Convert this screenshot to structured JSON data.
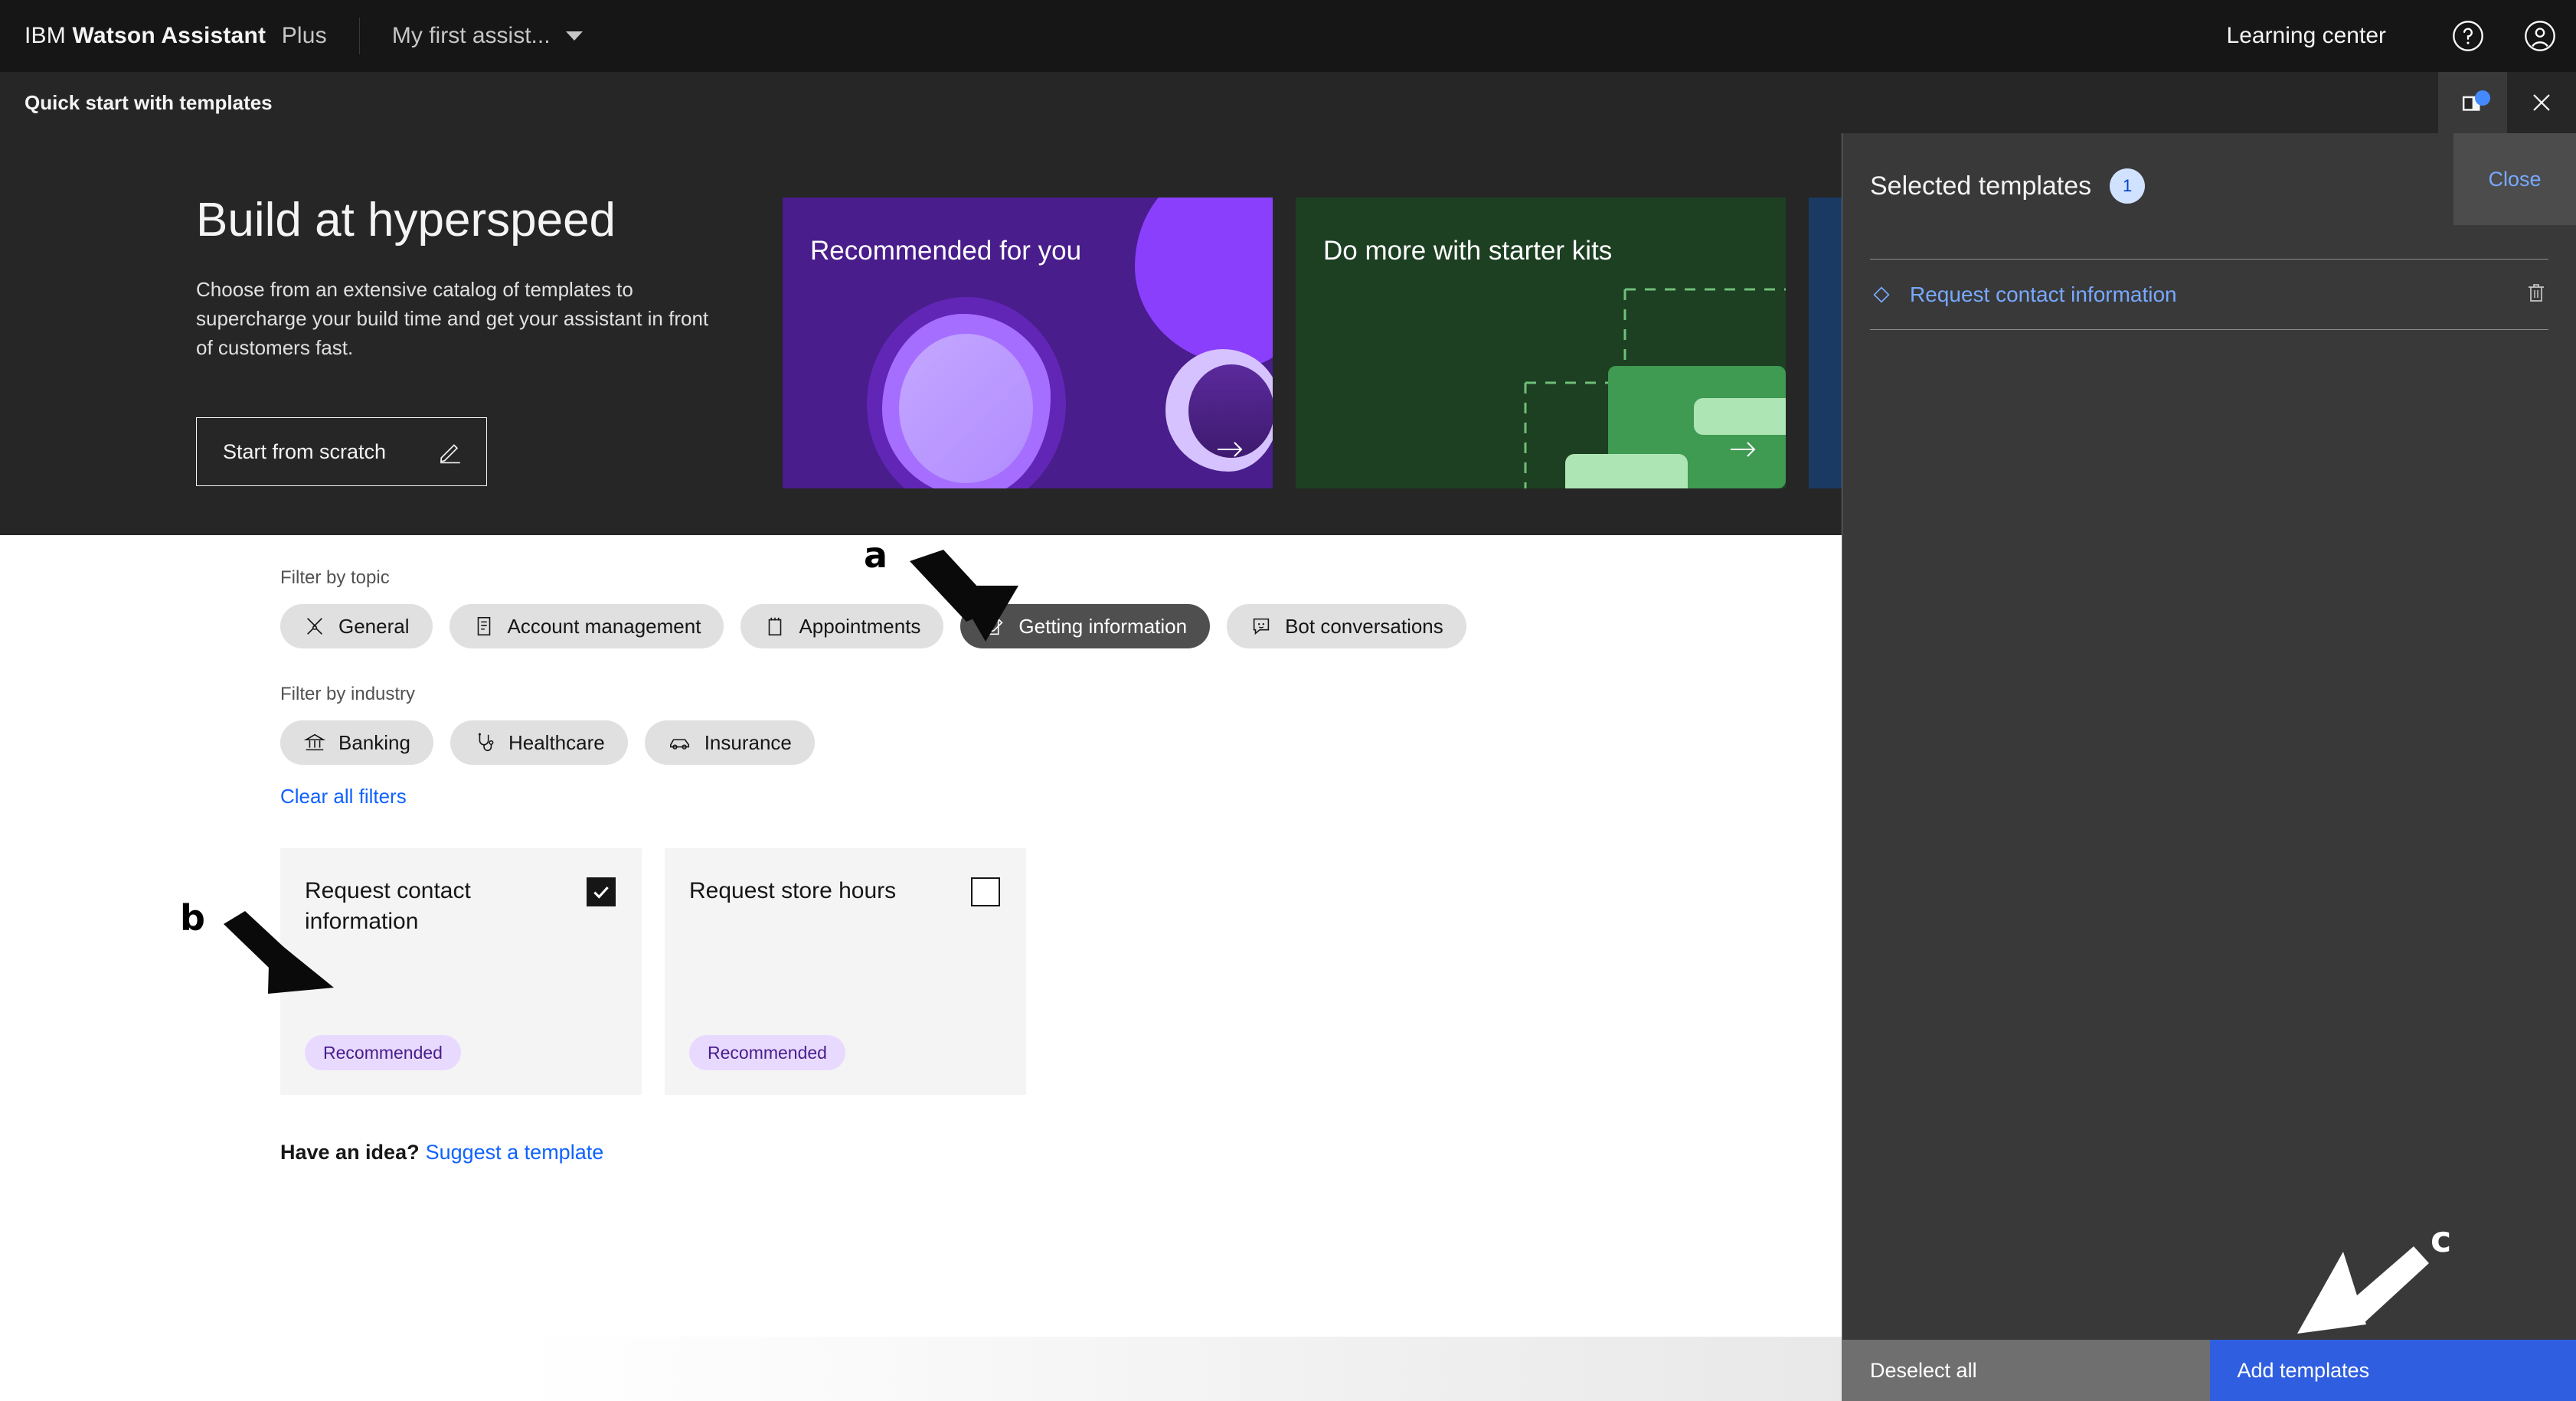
{
  "topbar": {
    "brand_prefix": "IBM",
    "brand_name": "Watson Assistant",
    "plan": "Plus",
    "assistant_name": "My first assist...",
    "learning_center": "Learning center",
    "help_icon": "help-circle-icon",
    "account_icon": "user-avatar-icon",
    "chevron_icon": "chevron-down-icon"
  },
  "panelbar": {
    "title": "Quick start with templates",
    "toggle_panel_icon": "side-panel-toggle-icon",
    "close_icon": "close-icon",
    "badge_color": "#4589ff"
  },
  "hero": {
    "heading": "Build at hyperspeed",
    "paragraph": "Choose from an extensive catalog of templates to supercharge your build time and get your assistant in front of customers fast.",
    "cta_label": "Start from scratch",
    "cta_icon": "edit-pencil-icon",
    "cards": [
      {
        "title": "Recommended for you",
        "color": "#491d8b",
        "arrow_icon": "arrow-right-icon"
      },
      {
        "title": "Do more with starter kits",
        "color": "#1d3f22",
        "arrow_icon": "arrow-right-icon"
      },
      {
        "title": "",
        "color": "#1a3a63",
        "arrow_icon": "arrow-right-icon"
      }
    ]
  },
  "filters": {
    "topic_label": "Filter by topic",
    "topic_chips": [
      {
        "label": "General",
        "icon": "tools-icon",
        "selected": false
      },
      {
        "label": "Account management",
        "icon": "document-list-icon",
        "selected": false
      },
      {
        "label": "Appointments",
        "icon": "calendar-icon",
        "selected": false
      },
      {
        "label": "Getting information",
        "icon": "edit-note-icon",
        "selected": true
      },
      {
        "label": "Bot conversations",
        "icon": "chat-bot-icon",
        "selected": false
      }
    ],
    "industry_label": "Filter by industry",
    "industry_chips": [
      {
        "label": "Banking",
        "icon": "bank-icon",
        "selected": false
      },
      {
        "label": "Healthcare",
        "icon": "stethoscope-icon",
        "selected": false
      },
      {
        "label": "Insurance",
        "icon": "car-icon",
        "selected": false
      }
    ],
    "clear_label": "Clear all filters"
  },
  "templates": [
    {
      "title": "Request contact information",
      "tag": "Recommended",
      "checked": true,
      "checkbox_icon": "checkbox-checked-icon"
    },
    {
      "title": "Request store hours",
      "tag": "Recommended",
      "checked": false,
      "checkbox_icon": "checkbox-unchecked-icon"
    }
  ],
  "idea": {
    "question": "Have an idea?",
    "link": "Suggest a template"
  },
  "sidepanel": {
    "title": "Selected templates",
    "count": "1",
    "close_label": "Close",
    "items": [
      {
        "label": "Request contact information",
        "leading_icon": "code-diamond-icon",
        "delete_icon": "trash-icon"
      }
    ],
    "deselect_label": "Deselect all",
    "add_label": "Add templates",
    "primary_color": "#2f5fe0"
  },
  "annotations": [
    {
      "letter": "a",
      "target": "getting-information-chip",
      "arrow": "black"
    },
    {
      "letter": "b",
      "target": "request-contact-information-card",
      "arrow": "black"
    },
    {
      "letter": "c",
      "target": "add-templates-button",
      "arrow": "white"
    }
  ]
}
